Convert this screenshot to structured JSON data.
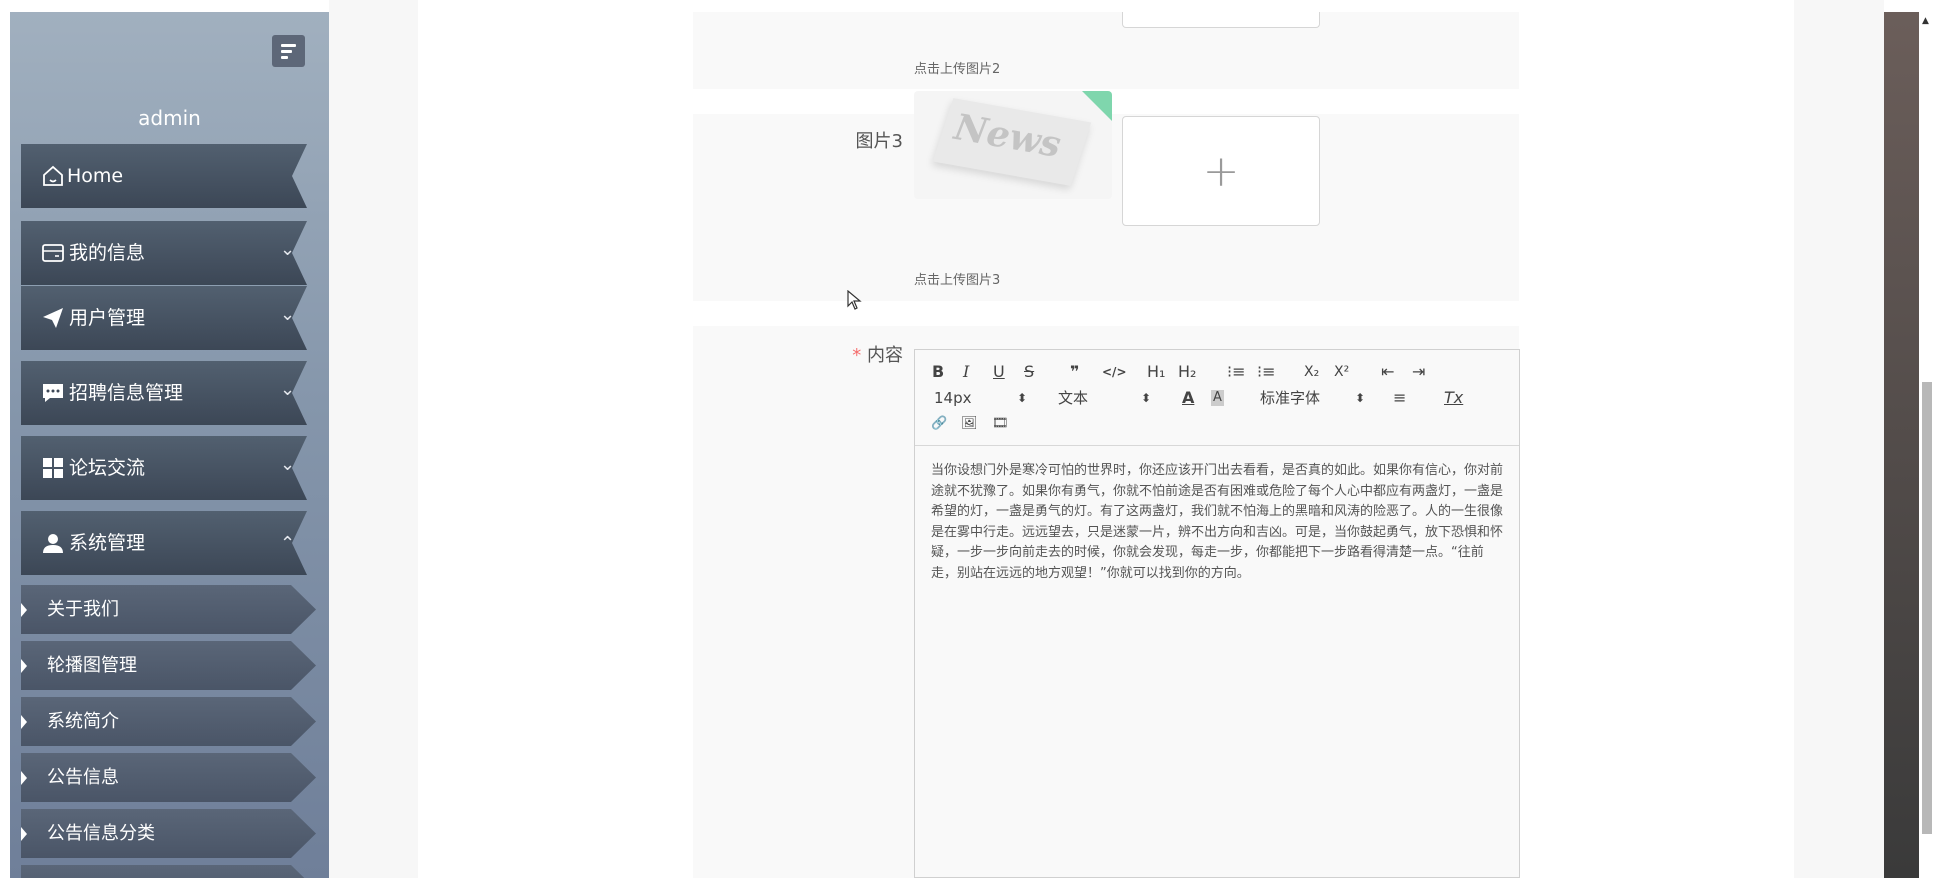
{
  "sidebar": {
    "username": "admin",
    "menu": [
      {
        "label": "Home",
        "icon": "home-icon"
      },
      {
        "label": "我的信息",
        "icon": "wallet-icon"
      },
      {
        "label": "用户管理",
        "icon": "paper-plane-icon"
      },
      {
        "label": "招聘信息管理",
        "icon": "chat-icon"
      },
      {
        "label": "论坛交流",
        "icon": "grid-icon"
      },
      {
        "label": "系统管理",
        "icon": "user-icon"
      }
    ],
    "submenu": [
      {
        "label": "关于我们"
      },
      {
        "label": "轮播图管理"
      },
      {
        "label": "系统简介"
      },
      {
        "label": "公告信息"
      },
      {
        "label": "公告信息分类"
      }
    ]
  },
  "form": {
    "image2_tip": "点击上传图片2",
    "image3_label": "图片3",
    "image3_tip": "点击上传图片3",
    "thumb_text": "News",
    "upload_plus": "+",
    "content_required": "*",
    "content_label": "内容"
  },
  "editor": {
    "toolbar": {
      "bold": "B",
      "italic": "I",
      "underline": "U",
      "strike": "S",
      "quote": "❞",
      "code": "</>",
      "h1": "H₁",
      "h2": "H₂",
      "ordered_list": "⁝≡",
      "bullet_list": "⁝≡",
      "subscript": "X₂",
      "superscript": "X²",
      "indent": "⇤",
      "outdent": "⇥",
      "font_size": "14px",
      "header_select": "文本",
      "color": "A",
      "background": "A",
      "font_family": "标准字体",
      "align": "≡",
      "clean": "Tx",
      "link": "🔗",
      "image": "🖼",
      "video": "🎞",
      "select_arrow": "⬍"
    },
    "content": "当你设想门外是寒冷可怕的世界时，你还应该开门出去看看，是否真的如此。如果你有信心，你对前途就不犹豫了。如果你有勇气，你就不怕前途是否有困难或危险了每个人心中都应有两盏灯，一盏是希望的灯，一盏是勇气的灯。有了这两盏灯，我们就不怕海上的黑暗和风涛的险恶了。人的一生很像是在雾中行走。远远望去，只是迷蒙一片，辨不出方向和吉凶。可是，当你鼓起勇气，放下恐惧和怀疑，一步一步向前走去的时候，你就会发现，每走一步，你都能把下一步路看得清楚一点。“往前走，别站在远远的地方观望！”你就可以找到你的方向。"
  },
  "scrollbar": {
    "up": "▲"
  },
  "colors": {
    "sidebar_top": "#a1b0bf",
    "menu_bg": "#3c4756",
    "required": "#f56c6c",
    "thumb_corner": "#7fd6ad"
  }
}
